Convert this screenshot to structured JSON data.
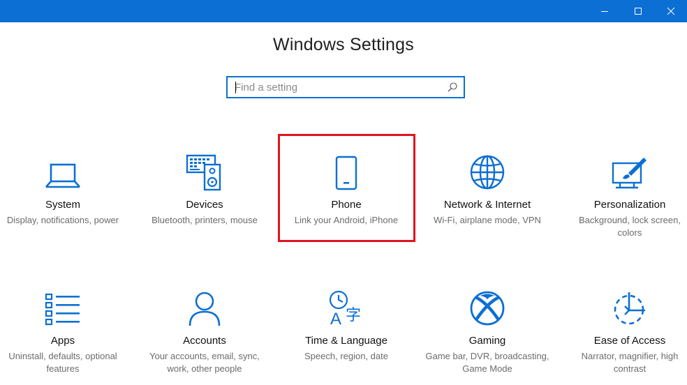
{
  "window": {
    "controls": [
      "minimize-icon",
      "maximize-icon",
      "close-icon"
    ],
    "accent_color": "#0c6fd3"
  },
  "page": {
    "title": "Windows Settings"
  },
  "search": {
    "placeholder": "Find a setting",
    "value": "",
    "icon": "search-icon"
  },
  "highlight_color": "#e0141e",
  "categories": [
    {
      "name": "System",
      "description": "Display, notifications, power",
      "icon": "laptop-icon"
    },
    {
      "name": "Devices",
      "description": "Bluetooth, printers, mouse",
      "icon": "keyboard-speaker-icon"
    },
    {
      "name": "Phone",
      "description": "Link your Android, iPhone",
      "icon": "phone-icon",
      "highlighted": true
    },
    {
      "name": "Network & Internet",
      "description": "Wi-Fi, airplane mode, VPN",
      "icon": "globe-icon"
    },
    {
      "name": "Personalization",
      "description": "Background, lock screen, colors",
      "icon": "paint-brush-icon"
    },
    {
      "name": "Apps",
      "description": "Uninstall, defaults, optional features",
      "icon": "app-list-icon"
    },
    {
      "name": "Accounts",
      "description": "Your accounts, email, sync, work, other people",
      "icon": "person-icon"
    },
    {
      "name": "Time & Language",
      "description": "Speech, region, date",
      "icon": "time-language-icon"
    },
    {
      "name": "Gaming",
      "description": "Game bar, DVR, broadcasting, Game Mode",
      "icon": "xbox-icon"
    },
    {
      "name": "Ease of Access",
      "description": "Narrator, magnifier, high contrast",
      "icon": "ease-of-access-icon"
    }
  ]
}
